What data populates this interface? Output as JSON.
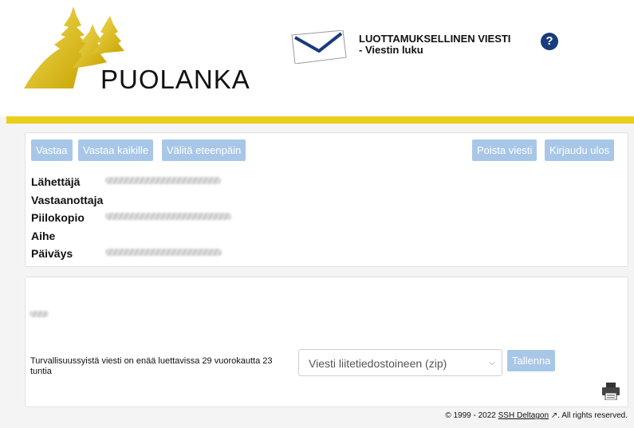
{
  "header": {
    "logo_text": "PUOLANKA",
    "title_line1": "LUOTTAMUKSELLINEN VIESTI",
    "title_line2": "- Viestin luku",
    "help_symbol": "?"
  },
  "colors": {
    "accent_yellow": "#e9ce1a",
    "button_blue": "#a8c7e8",
    "help_blue": "#1a3b7c",
    "logo_gold": "#e0c21a"
  },
  "toolbar": {
    "reply": "Vastaa",
    "reply_all": "Vastaa kaikille",
    "forward": "Välitä eteenpäin",
    "delete": "Poista viesti",
    "logout": "Kirjaudu ulos"
  },
  "meta": {
    "sender_label": "Lähettäjä",
    "recipient_label": "Vastaanottaja",
    "bcc_label": "Piilokopio",
    "subject_label": "Aihe",
    "date_label": "Päiväys"
  },
  "body": {
    "notice": "Turvallisuussyistä viesti on enää luettavissa 29 vuorokautta 23 tuntia",
    "download_select": "Viesti liitetiedostoineen (zip)",
    "save_button": "Tallenna"
  },
  "footer": {
    "copyright": "© 1999 - 2022",
    "link": "SSH Deltagon",
    "rights": ". All rights reserved."
  },
  "icons": [
    "logo-trees-icon",
    "envelope-icon",
    "help-icon",
    "external-link-icon",
    "printer-icon",
    "chevron-down-icon"
  ]
}
